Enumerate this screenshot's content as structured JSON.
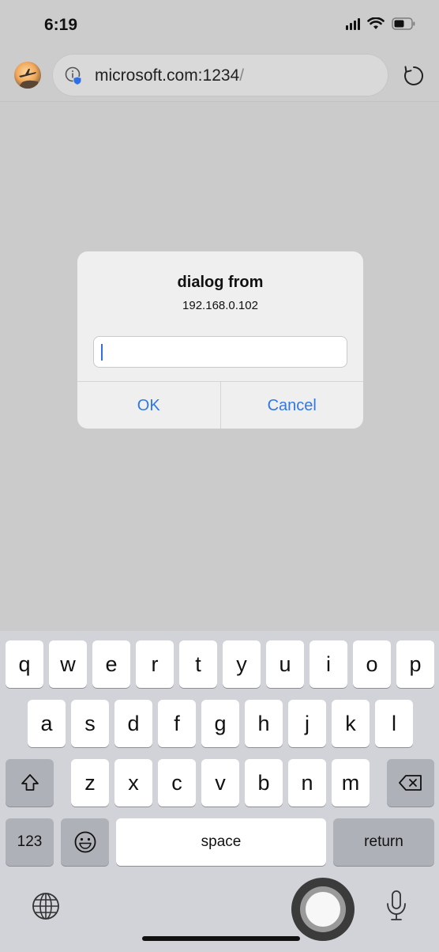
{
  "status_bar": {
    "time": "6:19"
  },
  "browser": {
    "url_host": "microsoft.com:1234",
    "url_path": "/"
  },
  "dialog": {
    "title": "dialog from",
    "message": "192.168.0.102",
    "input_value": "",
    "ok_label": "OK",
    "cancel_label": "Cancel"
  },
  "keyboard": {
    "row1": [
      "q",
      "w",
      "e",
      "r",
      "t",
      "y",
      "u",
      "i",
      "o",
      "p"
    ],
    "row2": [
      "a",
      "s",
      "d",
      "f",
      "g",
      "h",
      "j",
      "k",
      "l"
    ],
    "row3": [
      "z",
      "x",
      "c",
      "v",
      "b",
      "n",
      "m"
    ],
    "numbers_label": "123",
    "space_label": "space",
    "return_label": "return"
  },
  "icons": {
    "info": "info-shield-icon",
    "reload": "reload-icon",
    "shift": "shift-arrow-icon",
    "delete": "backspace-icon",
    "emoji": "emoji-icon",
    "globe": "globe-icon",
    "mic": "microphone-icon"
  },
  "colors": {
    "accent": "#2f78e4",
    "page_background": "#cbcbcb",
    "keyboard_background": "#d1d3d8"
  }
}
